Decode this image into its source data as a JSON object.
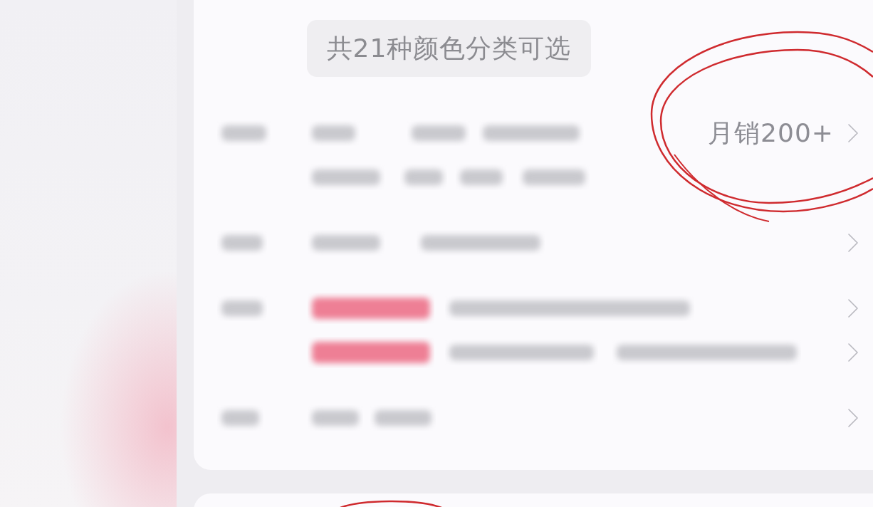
{
  "option_badge": "共21种颜色分类可选",
  "detail_rows": [
    {
      "kind": "sales",
      "reading": "月销200+"
    },
    {
      "kind": "plain"
    },
    {
      "kind": "promo"
    },
    {
      "kind": "plain"
    }
  ]
}
